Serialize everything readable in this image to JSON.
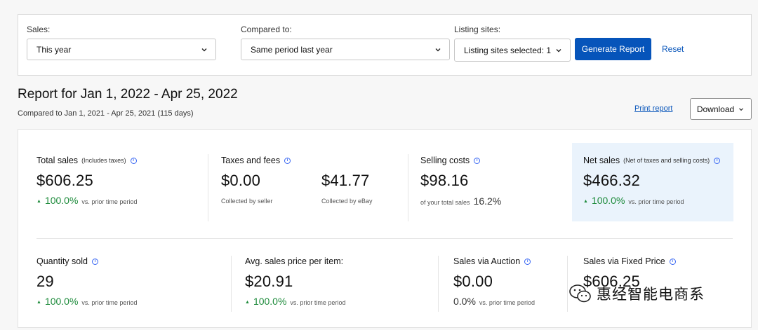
{
  "filters": {
    "sales_label": "Sales:",
    "sales_value": "This year",
    "compared_label": "Compared to:",
    "compared_value": "Same period last year",
    "sites_label": "Listing sites:",
    "sites_value": "Listing sites selected: 1",
    "generate_label": "Generate Report",
    "reset_label": "Reset"
  },
  "report": {
    "title": "Report for Jan 1, 2022 - Apr 25, 2022",
    "subtitle": "Compared to Jan 1, 2021 - Apr 25, 2021 (115 days)",
    "print_label": "Print report",
    "download_label": "Download"
  },
  "metrics": {
    "total_sales": {
      "label": "Total sales",
      "note": "(Includes taxes)",
      "value": "$606.25",
      "change": "100.0%",
      "vs": "vs. prior time period"
    },
    "taxes_fees": {
      "label": "Taxes and fees",
      "seller_value": "$0.00",
      "seller_note": "Collected by seller",
      "ebay_value": "$41.77",
      "ebay_note": "Collected by eBay"
    },
    "selling_costs": {
      "label": "Selling costs",
      "value": "$98.16",
      "note": "of your total sales",
      "pct": "16.2%"
    },
    "net_sales": {
      "label": "Net sales",
      "note": "(Net of taxes and selling costs)",
      "value": "$466.32",
      "change": "100.0%",
      "vs": "vs. prior time period"
    },
    "quantity_sold": {
      "label": "Quantity sold",
      "value": "29",
      "change": "100.0%",
      "vs": "vs. prior time period"
    },
    "avg_price": {
      "label": "Avg. sales price per item:",
      "value": "$20.91",
      "change": "100.0%",
      "vs": "vs. prior time period"
    },
    "auction": {
      "label": "Sales via Auction",
      "value": "$0.00",
      "change": "0.0%",
      "vs": "vs. prior time period"
    },
    "fixed_price": {
      "label": "Sales via Fixed Price",
      "value": "$606.25"
    }
  },
  "watermark": {
    "text": "惠经智能电商系"
  },
  "colors": {
    "primary": "#0654ba",
    "positive": "#1c8a3a",
    "highlight": "#eaf3fc"
  }
}
